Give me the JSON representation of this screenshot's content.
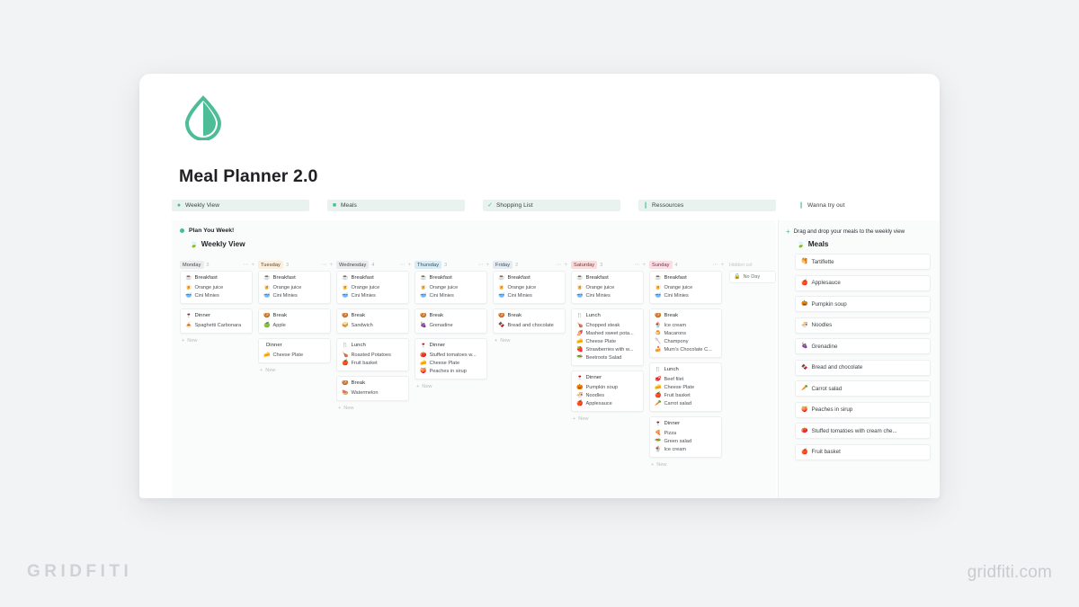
{
  "branding": {
    "left": "GRIDFITI",
    "right": "gridfiti.com"
  },
  "app": {
    "logo_name": "water-drop-logo",
    "page_title": "Meal Planner 2.0",
    "accent": "#46bd94"
  },
  "tabs": [
    {
      "icon": "●",
      "icon_name": "green-dot-icon",
      "label": "Weekly View",
      "icon_color": "#46bd94"
    },
    {
      "icon": "■",
      "icon_name": "green-square-icon",
      "label": "Meals",
      "icon_color": "#46bd94"
    },
    {
      "icon": "✓",
      "icon_name": "check-icon",
      "label": "Shopping List",
      "icon_color": "#46bd94"
    },
    {
      "icon": "❙",
      "icon_name": "bookmark-icon",
      "label": "Ressources",
      "icon_color": "#46bd94"
    },
    {
      "icon": "❙",
      "icon_name": "pin-icon",
      "label": "Wanna try out",
      "icon_color": "#46bd94"
    }
  ],
  "board": {
    "section_title": "Plan You Week!",
    "view_icon": "🍃",
    "view_icon_name": "weekly-view-icon",
    "view_title": "Weekly View",
    "new_label": "New",
    "hidden_label": "Hidden col",
    "no_day": {
      "icon": "🔒",
      "icon_name": "lock-icon",
      "label": "No Day"
    },
    "columns": [
      {
        "day": "Monday",
        "count": "2",
        "pill_bg": "#ebeced",
        "pill_fg": "#41464b",
        "cards": [
          {
            "icon": "☕",
            "title": "Breakfast",
            "items": [
              {
                "emoji": "🍺",
                "text": "Orange juice"
              },
              {
                "emoji": "🥣",
                "text": "Cini Minies"
              }
            ]
          },
          {
            "icon": "🍷",
            "title": "Dinner",
            "items": [
              {
                "emoji": "🍝",
                "text": "Spaghetti Carbonara"
              }
            ]
          }
        ]
      },
      {
        "day": "Tuesday",
        "count": "3",
        "pill_bg": "#fbeedc",
        "pill_fg": "#5d4a2e",
        "cards": [
          {
            "icon": "☕",
            "title": "Breakfast",
            "items": [
              {
                "emoji": "🍺",
                "text": "Orange juice"
              },
              {
                "emoji": "🥣",
                "text": "Cini Minies"
              }
            ]
          },
          {
            "icon": "🍪",
            "title": "Break",
            "items": [
              {
                "emoji": "🍏",
                "text": "Apple"
              }
            ]
          },
          {
            "icon": "",
            "title": "Dinner",
            "items": [
              {
                "emoji": "🧀",
                "text": "Cheese Plate"
              }
            ]
          }
        ]
      },
      {
        "day": "Wednesday",
        "count": "4",
        "pill_bg": "#ebeced",
        "pill_fg": "#41464b",
        "cards": [
          {
            "icon": "☕",
            "title": "Breakfast",
            "items": [
              {
                "emoji": "🍺",
                "text": "Orange juice"
              },
              {
                "emoji": "🥣",
                "text": "Cini Minies"
              }
            ]
          },
          {
            "icon": "🍪",
            "title": "Break",
            "items": [
              {
                "emoji": "🥪",
                "text": "Sandwich"
              }
            ]
          },
          {
            "icon": "🍴",
            "title": "Lunch",
            "items": [
              {
                "emoji": "🍗",
                "text": "Roasted Potatoes"
              },
              {
                "emoji": "🍎",
                "text": "Fruit basket"
              }
            ]
          },
          {
            "icon": "🍪",
            "title": "Break",
            "items": [
              {
                "emoji": "🍉",
                "text": "Watermelon"
              }
            ]
          }
        ]
      },
      {
        "day": "Thursday",
        "count": "3",
        "pill_bg": "#d9ecf6",
        "pill_fg": "#2c4c5d",
        "cards": [
          {
            "icon": "☕",
            "title": "Breakfast",
            "items": [
              {
                "emoji": "🍺",
                "text": "Orange juice"
              },
              {
                "emoji": "🥣",
                "text": "Cini Minies"
              }
            ]
          },
          {
            "icon": "🍪",
            "title": "Break",
            "items": [
              {
                "emoji": "🍇",
                "text": "Grenadine"
              }
            ]
          },
          {
            "icon": "🍷",
            "title": "Dinner",
            "items": [
              {
                "emoji": "🍅",
                "text": "Stuffed tomatoes w..."
              },
              {
                "emoji": "🧀",
                "text": "Cheese Plate"
              },
              {
                "emoji": "🍑",
                "text": "Peaches in sirup"
              }
            ]
          }
        ]
      },
      {
        "day": "Friday",
        "count": "2",
        "pill_bg": "#e4ecf2",
        "pill_fg": "#3a4a56",
        "cards": [
          {
            "icon": "☕",
            "title": "Breakfast",
            "items": [
              {
                "emoji": "🍺",
                "text": "Orange juice"
              },
              {
                "emoji": "🥣",
                "text": "Cini Minies"
              }
            ]
          },
          {
            "icon": "🍪",
            "title": "Break",
            "items": [
              {
                "emoji": "🍫",
                "text": "Bread and chocolate"
              }
            ]
          }
        ]
      },
      {
        "day": "Saturday",
        "count": "3",
        "pill_bg": "#fbdcdc",
        "pill_fg": "#6b3434",
        "cards": [
          {
            "icon": "☕",
            "title": "Breakfast",
            "items": [
              {
                "emoji": "🍺",
                "text": "Orange juice"
              },
              {
                "emoji": "🥣",
                "text": "Cini Minies"
              }
            ]
          },
          {
            "icon": "🍴",
            "title": "Lunch",
            "items": [
              {
                "emoji": "🍗",
                "text": "Chopped steak"
              },
              {
                "emoji": "🍠",
                "text": "Mashed sweet pota..."
              },
              {
                "emoji": "🧀",
                "text": "Cheese Plate"
              },
              {
                "emoji": "🍓",
                "text": "Strawberries with w..."
              },
              {
                "emoji": "🥗",
                "text": "Beetroots Salad"
              }
            ]
          },
          {
            "icon": "🍷",
            "title": "Dinner",
            "items": [
              {
                "emoji": "🎃",
                "text": "Pumpkin soup"
              },
              {
                "emoji": "🍜",
                "text": "Noodles"
              },
              {
                "emoji": "🍎",
                "text": "Applesauce"
              }
            ]
          }
        ]
      },
      {
        "day": "Sunday",
        "count": "4",
        "pill_bg": "#fbdde6",
        "pill_fg": "#6b3447",
        "cards": [
          {
            "icon": "☕",
            "title": "Breakfast",
            "items": [
              {
                "emoji": "🍺",
                "text": "Orange juice"
              },
              {
                "emoji": "🥣",
                "text": "Cini Minies"
              }
            ]
          },
          {
            "icon": "🍪",
            "title": "Break",
            "items": [
              {
                "emoji": "🍨",
                "text": "Ice cream"
              },
              {
                "emoji": "🍮",
                "text": "Macarons"
              },
              {
                "emoji": "🥄",
                "text": "Champony"
              },
              {
                "emoji": "🍰",
                "text": "Mum's Chocolate C..."
              }
            ]
          },
          {
            "icon": "🍴",
            "title": "Lunch",
            "items": [
              {
                "emoji": "🥩",
                "text": "Beef filet"
              },
              {
                "emoji": "🧀",
                "text": "Cheese Plate"
              },
              {
                "emoji": "🍎",
                "text": "Fruit basket"
              },
              {
                "emoji": "🥕",
                "text": "Carrot salad"
              }
            ]
          },
          {
            "icon": "🍷",
            "title": "Dinner",
            "items": [
              {
                "emoji": "🍕",
                "text": "Pizza"
              },
              {
                "emoji": "🥗",
                "text": "Green salad"
              },
              {
                "emoji": "🍨",
                "text": "Ice cream"
              }
            ]
          }
        ]
      }
    ]
  },
  "sidebar": {
    "note": "Drag and drop your meals to the weekly view",
    "title_icon": "🍃",
    "title_icon_name": "meals-icon",
    "title": "Meals",
    "meals": [
      {
        "emoji": "🥞",
        "text": "Tartiflette"
      },
      {
        "emoji": "🍎",
        "text": "Applesauce"
      },
      {
        "emoji": "🎃",
        "text": "Pumpkin soup"
      },
      {
        "emoji": "🍜",
        "text": "Noodles"
      },
      {
        "emoji": "🍇",
        "text": "Grenadine"
      },
      {
        "emoji": "🍫",
        "text": "Bread and chocolate"
      },
      {
        "emoji": "🥕",
        "text": "Carrot salad"
      },
      {
        "emoji": "🍑",
        "text": "Peaches in sirup"
      },
      {
        "emoji": "🍅",
        "text": "Stuffed tomatoes with cream che..."
      },
      {
        "emoji": "🍎",
        "text": "Fruit basket"
      }
    ]
  }
}
